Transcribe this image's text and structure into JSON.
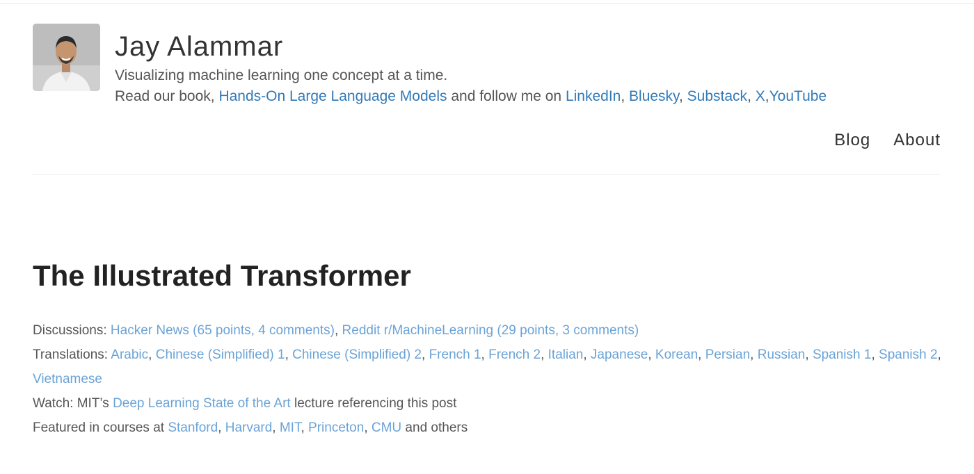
{
  "header": {
    "author_name": "Jay Alammar",
    "tagline": "Visualizing machine learning one concept at a time.",
    "follow_prefix": "Read our book, ",
    "book_link": "Hands-On Large Language Models",
    "follow_middle": " and follow me on ",
    "social_links": [
      "LinkedIn",
      "Bluesky",
      "Substack",
      "X",
      "YouTube"
    ],
    "nav": [
      "Blog",
      "About"
    ]
  },
  "post": {
    "title": "The Illustrated Transformer",
    "discussions_label": "Discussions: ",
    "discussions": [
      "Hacker News (65 points, 4 comments)",
      "Reddit r/MachineLearning (29 points, 3 comments)"
    ],
    "translations_label": "Translations: ",
    "translations": [
      "Arabic",
      "Chinese (Simplified) 1",
      "Chinese (Simplified) 2",
      "French 1",
      "French 2",
      "Italian",
      "Japanese",
      "Korean",
      "Persian",
      "Russian",
      "Spanish 1",
      "Spanish 2",
      "Vietnamese"
    ],
    "watch_prefix": "Watch: MIT’s ",
    "watch_link": "Deep Learning State of the Art",
    "watch_suffix": " lecture referencing this post",
    "featured_prefix": "Featured in courses at ",
    "courses": [
      "Stanford",
      "Harvard",
      "MIT",
      "Princeton",
      "CMU"
    ],
    "featured_suffix": " and others"
  },
  "colors": {
    "header_link": "#337ab7",
    "post_link": "#6ba3d6",
    "text": "#555555",
    "title": "#222222"
  }
}
